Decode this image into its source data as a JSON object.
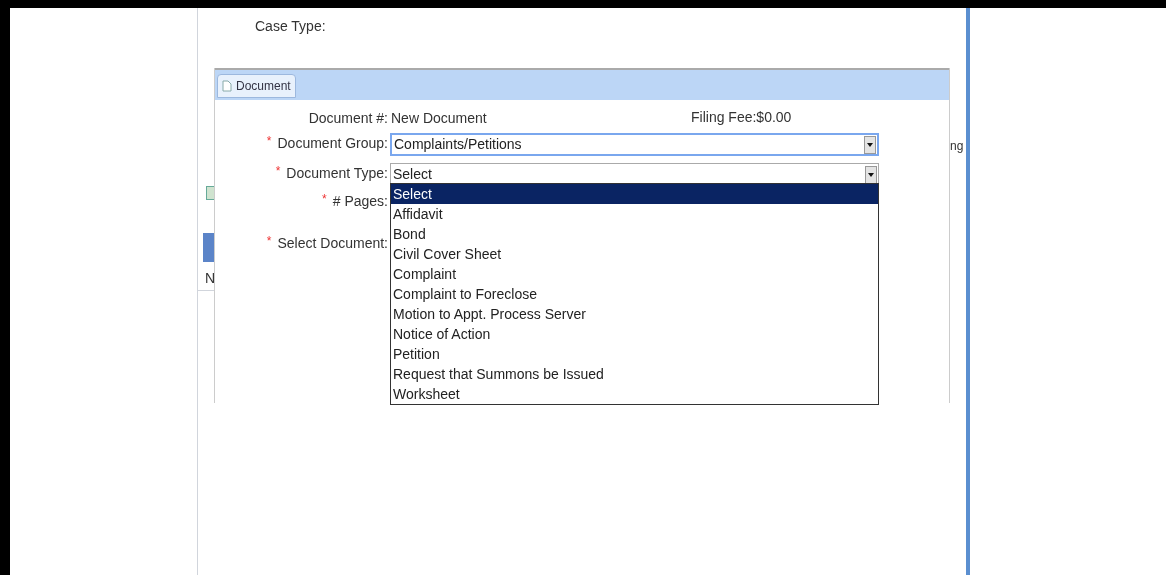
{
  "case_type_label": "Case Type:",
  "panel": {
    "tab": "Document"
  },
  "fields": [
    {
      "kind": "text",
      "label": "Document #:",
      "value": "New Document"
    },
    {
      "kind": "select",
      "label": "Document Group:",
      "required_mark": "*",
      "value": "Complaints/Petitions",
      "focused": true
    },
    {
      "kind": "select",
      "label": "Document Type:",
      "required_mark": "*",
      "value": "Select",
      "focused": false
    },
    {
      "kind": "blank",
      "label": "# Pages:",
      "required_mark": "*"
    },
    {
      "kind": "blank",
      "label": "Select Document:",
      "required_mark": "*"
    }
  ],
  "filing_fee": "Filing Fee:$0.00",
  "behind": {
    "letter": "N",
    "fragment": "ng"
  },
  "dropdown": [
    {
      "label": "Select",
      "selected": true
    },
    {
      "label": "Affidavit",
      "selected": false
    },
    {
      "label": "Bond",
      "selected": false
    },
    {
      "label": "Civil Cover Sheet",
      "selected": false
    },
    {
      "label": "Complaint",
      "selected": false
    },
    {
      "label": "Complaint to Foreclose",
      "selected": false
    },
    {
      "label": "Motion to Appt. Process Server",
      "selected": false
    },
    {
      "label": "Notice of Action",
      "selected": false
    },
    {
      "label": "Petition",
      "selected": false
    },
    {
      "label": "Request that Summons be Issued",
      "selected": false
    },
    {
      "label": "Worksheet",
      "selected": false
    }
  ]
}
